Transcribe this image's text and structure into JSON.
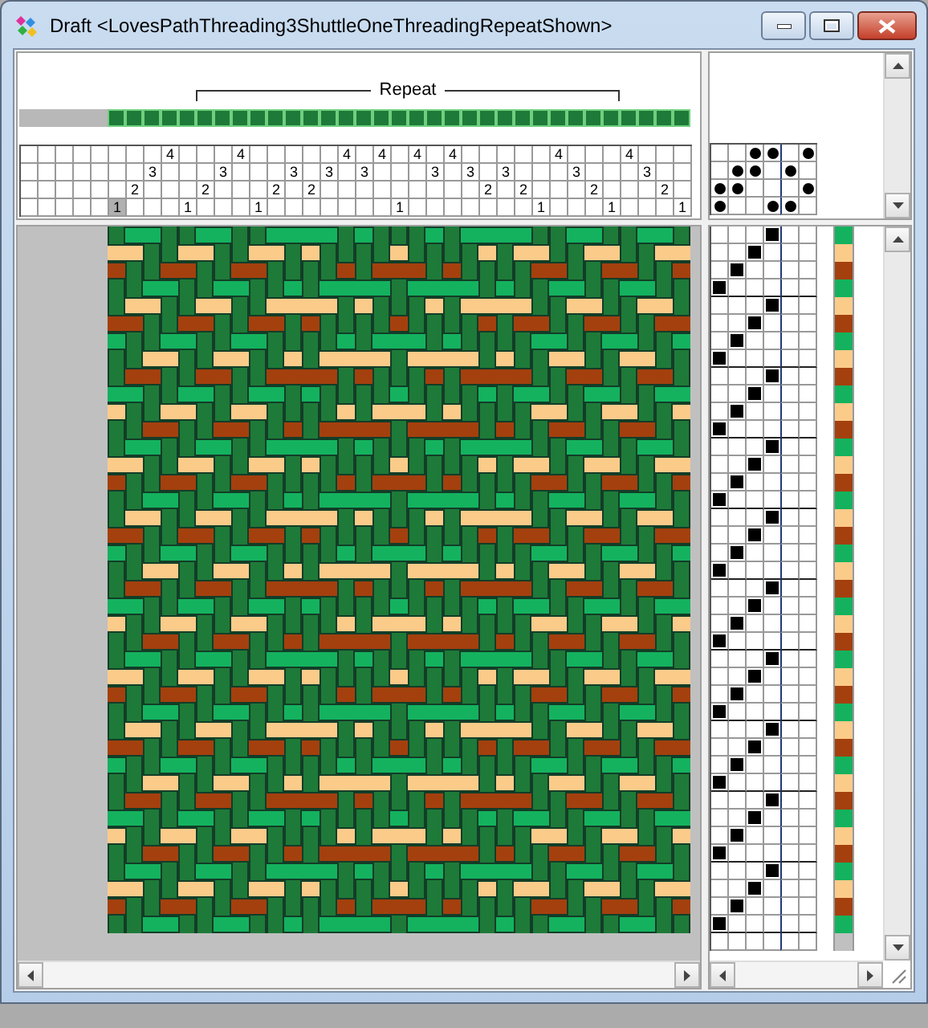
{
  "window": {
    "title": "Draft <LovesPathThreading3ShuttleOneThreadingRepeatShown>"
  },
  "threading": {
    "lead": [
      {
        "kind": "empty"
      },
      {
        "kind": "empty"
      },
      {
        "kind": "empty"
      },
      {
        "kind": "empty"
      },
      {
        "kind": "empty"
      },
      {
        "kind": "threaded",
        "shaft": "1",
        "selected": true
      },
      {
        "kind": "threaded",
        "shaft": "2",
        "selected": false
      },
      {
        "kind": "threaded",
        "shaft": "3",
        "selected": false
      },
      {
        "kind": "threaded",
        "shaft": "4",
        "selected": false
      },
      {
        "kind": "threaded",
        "shaft": "1",
        "selected": false
      }
    ],
    "repeat": {
      "label": "Repeat",
      "ends": [
        {
          "kind": "threaded",
          "shaft": "2",
          "selected": false
        },
        {
          "kind": "threaded",
          "shaft": "3",
          "selected": false
        },
        {
          "kind": "threaded",
          "shaft": "4",
          "selected": false
        },
        {
          "kind": "threaded",
          "shaft": "1",
          "selected": false
        },
        {
          "kind": "threaded",
          "shaft": "2",
          "selected": false
        },
        {
          "kind": "threaded",
          "shaft": "3",
          "selected": false
        },
        {
          "kind": "threaded",
          "shaft": "2",
          "selected": false
        },
        {
          "kind": "threaded",
          "shaft": "3",
          "selected": false
        },
        {
          "kind": "threaded",
          "shaft": "4",
          "selected": false
        },
        {
          "kind": "threaded",
          "shaft": "3",
          "selected": false
        },
        {
          "kind": "threaded",
          "shaft": "4",
          "selected": false
        },
        {
          "kind": "threaded",
          "shaft": "1",
          "selected": false
        },
        {
          "kind": "threaded",
          "shaft": "4",
          "selected": false
        },
        {
          "kind": "threaded",
          "shaft": "3",
          "selected": false
        },
        {
          "kind": "threaded",
          "shaft": "4",
          "selected": false
        },
        {
          "kind": "threaded",
          "shaft": "3",
          "selected": false
        },
        {
          "kind": "threaded",
          "shaft": "2",
          "selected": false
        },
        {
          "kind": "threaded",
          "shaft": "3",
          "selected": false
        },
        {
          "kind": "threaded",
          "shaft": "2",
          "selected": false
        },
        {
          "kind": "threaded",
          "shaft": "1",
          "selected": false
        },
        {
          "kind": "threaded",
          "shaft": "4",
          "selected": false
        },
        {
          "kind": "threaded",
          "shaft": "3",
          "selected": false
        },
        {
          "kind": "threaded",
          "shaft": "2",
          "selected": false
        },
        {
          "kind": "threaded",
          "shaft": "1",
          "selected": false
        }
      ]
    },
    "tail": [
      {
        "kind": "threaded",
        "shaft": "4",
        "selected": false
      },
      {
        "kind": "threaded",
        "shaft": "3",
        "selected": false
      },
      {
        "kind": "threaded",
        "shaft": "2",
        "selected": false
      },
      {
        "kind": "threaded",
        "shaft": "1",
        "selected": false
      }
    ]
  },
  "tieup": {
    "rows": [
      {
        "cells": [
          {
            "tied": false
          },
          {
            "tied": false
          },
          {
            "tied": true
          },
          {
            "tied": true
          },
          {
            "tied": false
          },
          {
            "tied": true
          }
        ]
      },
      {
        "cells": [
          {
            "tied": false
          },
          {
            "tied": true
          },
          {
            "tied": true
          },
          {
            "tied": false
          },
          {
            "tied": true
          },
          {
            "tied": false
          }
        ]
      },
      {
        "cells": [
          {
            "tied": true
          },
          {
            "tied": true
          },
          {
            "tied": false
          },
          {
            "tied": false
          },
          {
            "tied": false
          },
          {
            "tied": true
          }
        ]
      },
      {
        "cells": [
          {
            "tied": true
          },
          {
            "tied": false
          },
          {
            "tied": false
          },
          {
            "tied": true
          },
          {
            "tied": true
          },
          {
            "tied": false
          }
        ]
      }
    ]
  },
  "picks": [
    {
      "kind": "woven",
      "color": "#14b25e",
      "treadles": [
        false,
        false,
        false,
        true,
        false,
        false
      ]
    },
    {
      "kind": "woven",
      "color": "#fbcb8a",
      "treadles": [
        false,
        false,
        true,
        false,
        false,
        false
      ]
    },
    {
      "kind": "woven",
      "color": "#a4400e",
      "treadles": [
        false,
        true,
        false,
        false,
        false,
        false
      ]
    },
    {
      "kind": "woven",
      "color": "#14b25e",
      "treadles": [
        true,
        false,
        false,
        false,
        false,
        false
      ]
    },
    {
      "kind": "woven",
      "color": "#fbcb8a",
      "treadles": [
        false,
        false,
        false,
        true,
        false,
        false
      ]
    },
    {
      "kind": "woven",
      "color": "#a4400e",
      "treadles": [
        false,
        false,
        true,
        false,
        false,
        false
      ]
    },
    {
      "kind": "woven",
      "color": "#14b25e",
      "treadles": [
        false,
        true,
        false,
        false,
        false,
        false
      ]
    },
    {
      "kind": "woven",
      "color": "#fbcb8a",
      "treadles": [
        true,
        false,
        false,
        false,
        false,
        false
      ]
    },
    {
      "kind": "woven",
      "color": "#a4400e",
      "treadles": [
        false,
        false,
        false,
        true,
        false,
        false
      ]
    },
    {
      "kind": "woven",
      "color": "#14b25e",
      "treadles": [
        false,
        false,
        true,
        false,
        false,
        false
      ]
    },
    {
      "kind": "woven",
      "color": "#fbcb8a",
      "treadles": [
        false,
        true,
        false,
        false,
        false,
        false
      ]
    },
    {
      "kind": "woven",
      "color": "#a4400e",
      "treadles": [
        true,
        false,
        false,
        false,
        false,
        false
      ]
    },
    {
      "kind": "woven",
      "color": "#14b25e",
      "treadles": [
        false,
        false,
        false,
        true,
        false,
        false
      ]
    },
    {
      "kind": "woven",
      "color": "#fbcb8a",
      "treadles": [
        false,
        false,
        true,
        false,
        false,
        false
      ]
    },
    {
      "kind": "woven",
      "color": "#a4400e",
      "treadles": [
        false,
        true,
        false,
        false,
        false,
        false
      ]
    },
    {
      "kind": "woven",
      "color": "#14b25e",
      "treadles": [
        true,
        false,
        false,
        false,
        false,
        false
      ]
    },
    {
      "kind": "woven",
      "color": "#fbcb8a",
      "treadles": [
        false,
        false,
        false,
        true,
        false,
        false
      ]
    },
    {
      "kind": "woven",
      "color": "#a4400e",
      "treadles": [
        false,
        false,
        true,
        false,
        false,
        false
      ]
    },
    {
      "kind": "woven",
      "color": "#14b25e",
      "treadles": [
        false,
        true,
        false,
        false,
        false,
        false
      ]
    },
    {
      "kind": "woven",
      "color": "#fbcb8a",
      "treadles": [
        true,
        false,
        false,
        false,
        false,
        false
      ]
    },
    {
      "kind": "woven",
      "color": "#a4400e",
      "treadles": [
        false,
        false,
        false,
        true,
        false,
        false
      ]
    },
    {
      "kind": "woven",
      "color": "#14b25e",
      "treadles": [
        false,
        false,
        true,
        false,
        false,
        false
      ]
    },
    {
      "kind": "woven",
      "color": "#fbcb8a",
      "treadles": [
        false,
        true,
        false,
        false,
        false,
        false
      ]
    },
    {
      "kind": "woven",
      "color": "#a4400e",
      "treadles": [
        true,
        false,
        false,
        false,
        false,
        false
      ]
    },
    {
      "kind": "woven",
      "color": "#14b25e",
      "treadles": [
        false,
        false,
        false,
        true,
        false,
        false
      ]
    },
    {
      "kind": "woven",
      "color": "#fbcb8a",
      "treadles": [
        false,
        false,
        true,
        false,
        false,
        false
      ]
    },
    {
      "kind": "woven",
      "color": "#a4400e",
      "treadles": [
        false,
        true,
        false,
        false,
        false,
        false
      ]
    },
    {
      "kind": "woven",
      "color": "#14b25e",
      "treadles": [
        true,
        false,
        false,
        false,
        false,
        false
      ]
    },
    {
      "kind": "woven",
      "color": "#fbcb8a",
      "treadles": [
        false,
        false,
        false,
        true,
        false,
        false
      ]
    },
    {
      "kind": "woven",
      "color": "#a4400e",
      "treadles": [
        false,
        false,
        true,
        false,
        false,
        false
      ]
    },
    {
      "kind": "woven",
      "color": "#14b25e",
      "treadles": [
        false,
        true,
        false,
        false,
        false,
        false
      ]
    },
    {
      "kind": "woven",
      "color": "#fbcb8a",
      "treadles": [
        true,
        false,
        false,
        false,
        false,
        false
      ]
    },
    {
      "kind": "woven",
      "color": "#a4400e",
      "treadles": [
        false,
        false,
        false,
        true,
        false,
        false
      ]
    },
    {
      "kind": "woven",
      "color": "#14b25e",
      "treadles": [
        false,
        false,
        true,
        false,
        false,
        false
      ]
    },
    {
      "kind": "woven",
      "color": "#fbcb8a",
      "treadles": [
        false,
        true,
        false,
        false,
        false,
        false
      ]
    },
    {
      "kind": "woven",
      "color": "#a4400e",
      "treadles": [
        true,
        false,
        false,
        false,
        false,
        false
      ]
    },
    {
      "kind": "woven",
      "color": "#14b25e",
      "treadles": [
        false,
        false,
        false,
        true,
        false,
        false
      ]
    },
    {
      "kind": "woven",
      "color": "#fbcb8a",
      "treadles": [
        false,
        false,
        true,
        false,
        false,
        false
      ]
    },
    {
      "kind": "woven",
      "color": "#a4400e",
      "treadles": [
        false,
        true,
        false,
        false,
        false,
        false
      ]
    },
    {
      "kind": "woven",
      "color": "#14b25e",
      "treadles": [
        true,
        false,
        false,
        false,
        false,
        false
      ]
    },
    {
      "kind": "empty",
      "treadles": [
        false,
        false,
        false,
        false,
        false,
        false
      ]
    }
  ]
}
